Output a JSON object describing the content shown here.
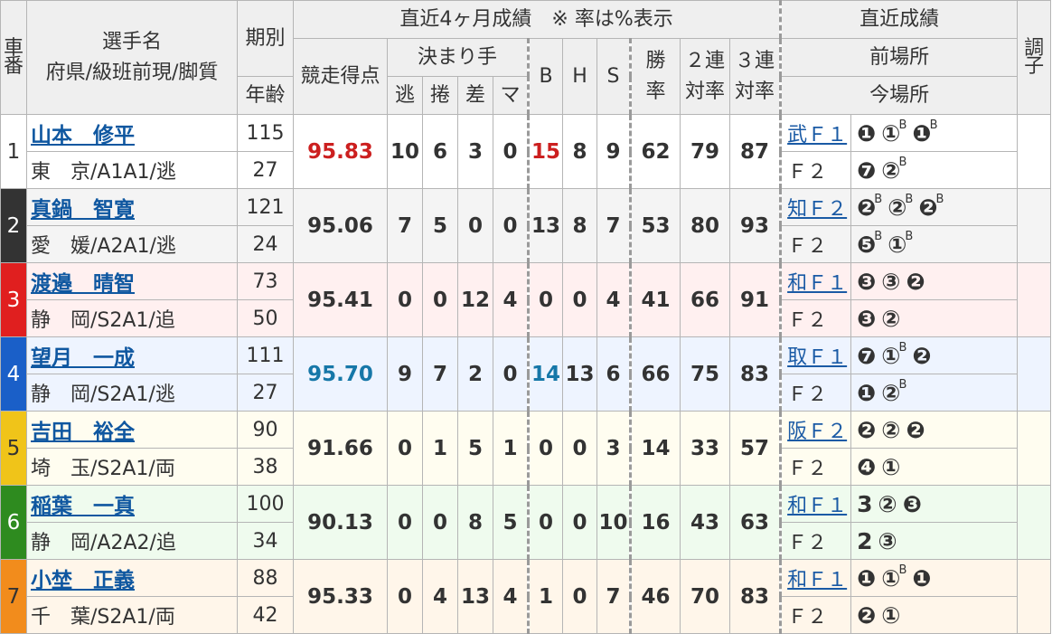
{
  "header": {
    "car_no": "車\n番",
    "player": "選手名\n府県/級班前現/脚質",
    "term": "期別",
    "age": "年齢",
    "recent4": "直近4ヶ月成績　※ 率は%表示",
    "score": "競走得点",
    "kimarite": "決まり手",
    "nige": "逃",
    "makuri": "捲",
    "sashi": "差",
    "mark": "マ",
    "b": "B",
    "h": "H",
    "s": "S",
    "win": "勝\n率",
    "ren2": "２連\n対率",
    "ren3": "３連\n対率",
    "recent_results": "直近成績",
    "prev_venue": "前場所",
    "this_venue": "今場所",
    "condition": "調\n子"
  },
  "riders": [
    {
      "car": "1",
      "car_bg": "#ffffff",
      "car_fg": "#333333",
      "row_class": "w1",
      "name": "山本　修平",
      "pref": "東　京/A1A1/逃",
      "term": "115",
      "age": "27",
      "score": "95.83",
      "score_color": "red",
      "nige": "10",
      "makuri": "6",
      "sashi": "3",
      "mark": "0",
      "b": "15",
      "b_color": "red",
      "h": "8",
      "s": "9",
      "win": "62",
      "ren2": "79",
      "ren3": "87",
      "prev": "武Ｆ１",
      "prev_results": [
        {
          "r": "❶",
          "sup": ""
        },
        {
          "r": "①",
          "sup": "B"
        },
        {
          "r": "❶",
          "sup": "B"
        }
      ],
      "this": "Ｆ２",
      "this_results": [
        {
          "r": "❼",
          "sup": ""
        },
        {
          "r": "②",
          "sup": "B"
        }
      ]
    },
    {
      "car": "2",
      "car_bg": "#333333",
      "car_fg": "#ffffff",
      "row_class": "w2",
      "name": "真鍋　智寛",
      "pref": "愛　媛/A2A1/逃",
      "term": "121",
      "age": "24",
      "score": "95.06",
      "score_color": "",
      "nige": "7",
      "makuri": "5",
      "sashi": "0",
      "mark": "0",
      "b": "13",
      "b_color": "",
      "h": "8",
      "s": "7",
      "win": "53",
      "ren2": "80",
      "ren3": "93",
      "prev": "知Ｆ２",
      "prev_results": [
        {
          "r": "❷",
          "sup": "B"
        },
        {
          "r": "②",
          "sup": "B"
        },
        {
          "r": "❷",
          "sup": "B"
        }
      ],
      "this": "Ｆ２",
      "this_results": [
        {
          "r": "❺",
          "sup": "B"
        },
        {
          "r": "①",
          "sup": "B"
        }
      ]
    },
    {
      "car": "3",
      "car_bg": "#e01f1f",
      "car_fg": "#ffffff",
      "row_class": "w3",
      "name": "渡邉　晴智",
      "pref": "静　岡/S2A1/追",
      "term": "73",
      "age": "50",
      "score": "95.41",
      "score_color": "",
      "nige": "0",
      "makuri": "0",
      "sashi": "12",
      "mark": "4",
      "b": "0",
      "b_color": "",
      "h": "0",
      "s": "4",
      "win": "41",
      "ren2": "66",
      "ren3": "91",
      "prev": "和Ｆ１",
      "prev_results": [
        {
          "r": "❸",
          "sup": ""
        },
        {
          "r": "③",
          "sup": ""
        },
        {
          "r": "❷",
          "sup": ""
        }
      ],
      "this": "Ｆ２",
      "this_results": [
        {
          "r": "❸",
          "sup": ""
        },
        {
          "r": "②",
          "sup": ""
        }
      ]
    },
    {
      "car": "4",
      "car_bg": "#1a5fc8",
      "car_fg": "#ffffff",
      "row_class": "w4",
      "name": "望月　一成",
      "pref": "静　岡/S2A1/逃",
      "term": "111",
      "age": "27",
      "score": "95.70",
      "score_color": "blue",
      "nige": "9",
      "makuri": "7",
      "sashi": "2",
      "mark": "0",
      "b": "14",
      "b_color": "blue",
      "h": "13",
      "s": "6",
      "win": "66",
      "ren2": "75",
      "ren3": "83",
      "prev": "取Ｆ１",
      "prev_results": [
        {
          "r": "❼",
          "sup": ""
        },
        {
          "r": "①",
          "sup": "B"
        },
        {
          "r": "❷",
          "sup": ""
        }
      ],
      "this": "Ｆ２",
      "this_results": [
        {
          "r": "❶",
          "sup": ""
        },
        {
          "r": "②",
          "sup": "B"
        }
      ]
    },
    {
      "car": "5",
      "car_bg": "#f0c419",
      "car_fg": "#333333",
      "row_class": "w5",
      "name": "吉田　裕全",
      "pref": "埼　玉/S2A1/両",
      "term": "90",
      "age": "38",
      "score": "91.66",
      "score_color": "",
      "nige": "0",
      "makuri": "1",
      "sashi": "5",
      "mark": "1",
      "b": "0",
      "b_color": "",
      "h": "0",
      "s": "3",
      "win": "14",
      "ren2": "33",
      "ren3": "57",
      "prev": "阪Ｆ２",
      "prev_results": [
        {
          "r": "❷",
          "sup": ""
        },
        {
          "r": "②",
          "sup": ""
        },
        {
          "r": "❷",
          "sup": ""
        }
      ],
      "this": "Ｆ２",
      "this_results": [
        {
          "r": "❹",
          "sup": ""
        },
        {
          "r": "①",
          "sup": ""
        }
      ]
    },
    {
      "car": "6",
      "car_bg": "#2e8b1f",
      "car_fg": "#ffffff",
      "row_class": "w6",
      "name": "稲葉　一真",
      "pref": "静　岡/A2A2/追",
      "term": "100",
      "age": "34",
      "score": "90.13",
      "score_color": "",
      "nige": "0",
      "makuri": "0",
      "sashi": "8",
      "mark": "5",
      "b": "0",
      "b_color": "",
      "h": "0",
      "s": "10",
      "win": "16",
      "ren2": "43",
      "ren3": "63",
      "prev": "和Ｆ１",
      "prev_results": [
        {
          "r": "3",
          "sup": ""
        },
        {
          "r": "②",
          "sup": ""
        },
        {
          "r": "❸",
          "sup": ""
        }
      ],
      "this": "Ｆ２",
      "this_results": [
        {
          "r": "2",
          "sup": ""
        },
        {
          "r": "③",
          "sup": ""
        }
      ]
    },
    {
      "car": "7",
      "car_bg": "#f28c1c",
      "car_fg": "#333333",
      "row_class": "w7",
      "name": "小埜　正義",
      "pref": "千　葉/S2A1/両",
      "term": "88",
      "age": "42",
      "score": "95.33",
      "score_color": "",
      "nige": "0",
      "makuri": "4",
      "sashi": "13",
      "mark": "4",
      "b": "1",
      "b_color": "",
      "h": "0",
      "s": "7",
      "win": "46",
      "ren2": "70",
      "ren3": "83",
      "prev": "和Ｆ１",
      "prev_results": [
        {
          "r": "❶",
          "sup": ""
        },
        {
          "r": "①",
          "sup": "B"
        },
        {
          "r": "❶",
          "sup": ""
        }
      ],
      "this": "Ｆ２",
      "this_results": [
        {
          "r": "❷",
          "sup": ""
        },
        {
          "r": "①",
          "sup": ""
        }
      ]
    }
  ]
}
